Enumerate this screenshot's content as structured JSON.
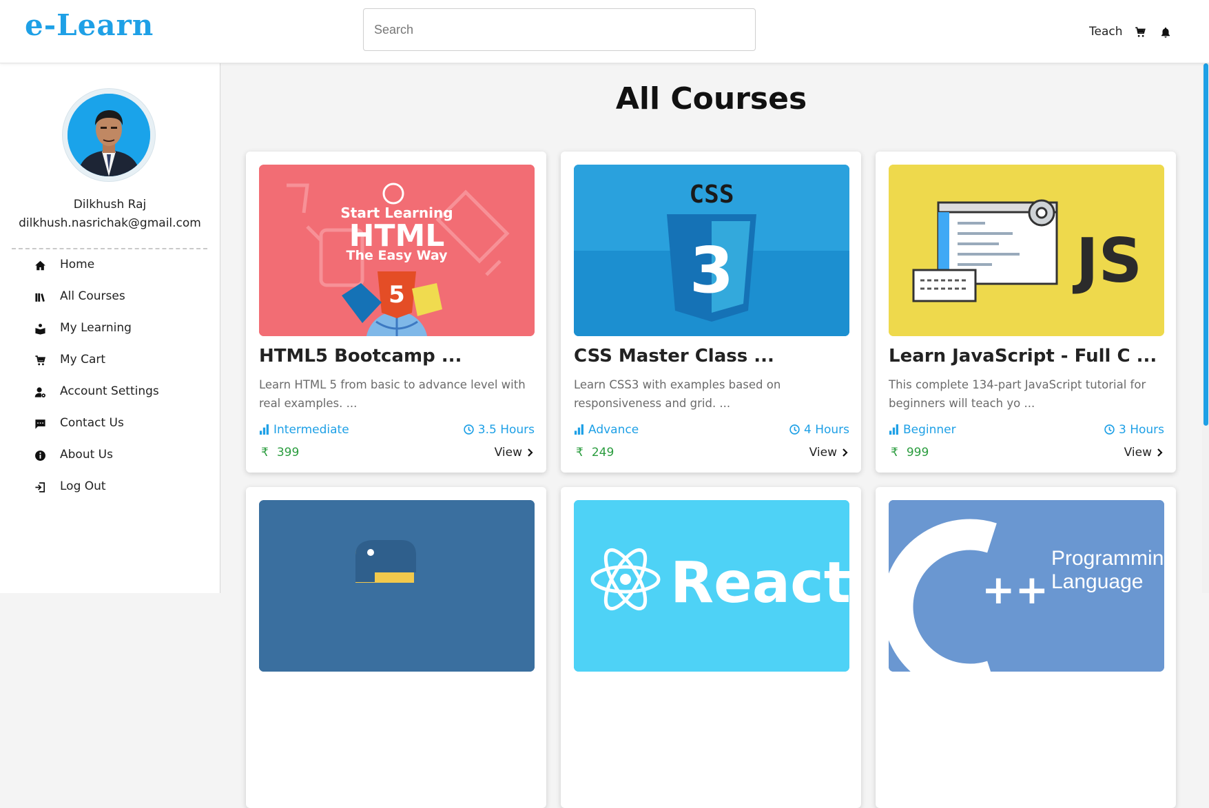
{
  "header": {
    "logo": "e-Learn",
    "search_placeholder": "Search",
    "teach_label": "Teach",
    "cart_icon": "cart-icon",
    "bell_icon": "bell-icon"
  },
  "sidebar": {
    "user_name": "Dilkhush Raj",
    "user_email": "dilkhush.nasrichak@gmail.com",
    "items": [
      {
        "label": "Home",
        "icon": "home-icon"
      },
      {
        "label": "All Courses",
        "icon": "books-icon"
      },
      {
        "label": "My Learning",
        "icon": "reader-icon"
      },
      {
        "label": "My Cart",
        "icon": "cart-icon"
      },
      {
        "label": "Account Settings",
        "icon": "user-gear-icon"
      },
      {
        "label": "Contact Us",
        "icon": "chat-icon"
      },
      {
        "label": "About Us",
        "icon": "info-icon"
      },
      {
        "label": "Log Out",
        "icon": "logout-icon"
      }
    ]
  },
  "main": {
    "title": "All Courses",
    "courses": [
      {
        "title": "HTML5 Bootcamp ...",
        "description": "Learn HTML 5 from basic to advance level with real examples. ...",
        "level": "Intermediate",
        "duration": "3.5 Hours",
        "currency": "₹",
        "price": "399",
        "view_label": "View",
        "thumb_text": [
          "Start Learning",
          "HTML",
          "The Easy Way"
        ]
      },
      {
        "title": "CSS Master Class ...",
        "description": "Learn CSS3 with examples based on responsiveness and grid. ...",
        "level": "Advance",
        "duration": "4 Hours",
        "currency": "₹",
        "price": "249",
        "view_label": "View",
        "thumb_text": [
          "CSS",
          "3"
        ]
      },
      {
        "title": "Learn JavaScript - Full C ...",
        "description": "This complete 134-part JavaScript tutorial for beginners will teach yo ...",
        "level": "Beginner",
        "duration": "3 Hours",
        "currency": "₹",
        "price": "999",
        "view_label": "View",
        "thumb_text": [
          "JS"
        ]
      },
      {
        "thumb_text": []
      },
      {
        "thumb_text": [
          "React"
        ]
      },
      {
        "thumb_text": [
          "Programmin",
          "Language",
          "++"
        ]
      }
    ]
  },
  "colors": {
    "accent": "#1ea0e6",
    "price_green": "#2a9c3e",
    "html_thumb": "#f26d74",
    "css_thumb": "#2aa1dd",
    "js_thumb": "#eed94c",
    "python_thumb": "#3a6f9f",
    "react_thumb": "#4ed2f6",
    "cpp_thumb": "#6a97d1"
  }
}
